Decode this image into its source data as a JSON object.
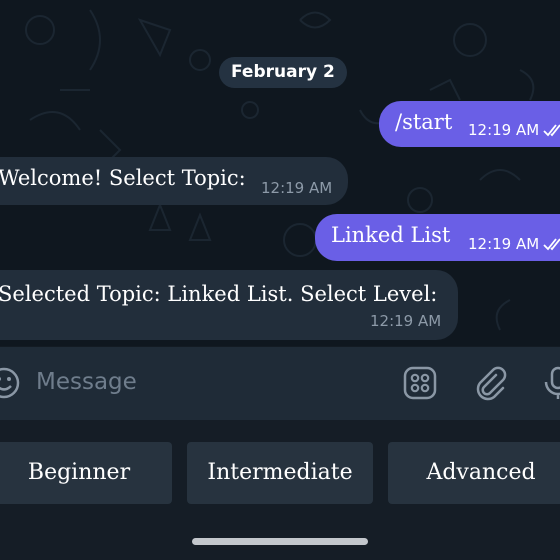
{
  "chat": {
    "date_separator": "February 2",
    "messages": [
      {
        "direction": "outgoing",
        "text": "/start",
        "time": "12:19 AM",
        "status": "read"
      },
      {
        "direction": "incoming",
        "text": "Welcome! Select Topic:",
        "time": "12:19 AM"
      },
      {
        "direction": "outgoing",
        "text": "Linked List",
        "time": "12:19 AM",
        "status": "read"
      },
      {
        "direction": "incoming",
        "text": "Selected Topic: Linked List. Select Level:",
        "time": "12:19 AM"
      }
    ]
  },
  "composer": {
    "placeholder": "Message",
    "icons": [
      "emoji-icon",
      "bot-commands-icon",
      "attach-icon",
      "microphone-icon"
    ]
  },
  "reply_keyboard": {
    "buttons": [
      "Beginner",
      "Intermediate",
      "Advanced"
    ]
  },
  "colors": {
    "outgoing_bubble": "#6a5fe6",
    "incoming_bubble": "#222e3b",
    "background": "#0f171f",
    "keyboard_button": "#27333f"
  }
}
